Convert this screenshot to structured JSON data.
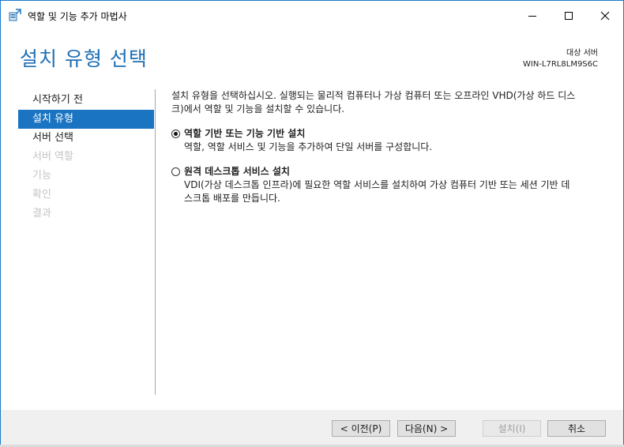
{
  "window": {
    "title": "역할 및 기능 추가 마법사"
  },
  "header": {
    "page_title": "설치 유형 선택",
    "server_label": "대상 서버",
    "server_name": "WIN-L7RL8LM9S6C"
  },
  "nav": {
    "items": [
      {
        "label": "시작하기 전",
        "state": "normal"
      },
      {
        "label": "설치 유형",
        "state": "active"
      },
      {
        "label": "서버 선택",
        "state": "normal"
      },
      {
        "label": "서버 역할",
        "state": "disabled"
      },
      {
        "label": "기능",
        "state": "disabled"
      },
      {
        "label": "확인",
        "state": "disabled"
      },
      {
        "label": "결과",
        "state": "disabled"
      }
    ]
  },
  "content": {
    "intro_line1": "설치 유형을 선택하십시오. 실행되는 물리적 컴퓨터나 가상 컴퓨터 또는 오프라인 VHD(가상 하드 디스",
    "intro_line2": "크)에서 역할 및 기능을 설치할 수 있습니다.",
    "options": [
      {
        "label": "역할 기반 또는 기능 기반 설치",
        "desc_line1": "역할, 역할 서비스 및 기능을 추가하여 단일 서버를 구성합니다.",
        "desc_line2": "",
        "selected": true
      },
      {
        "label": "원격 데스크톱 서비스 설치",
        "desc_line1": "VDI(가상 데스크톱 인프라)에 필요한 역할 서비스를 설치하여 가상 컴퓨터 기반 또는 세션 기반 데",
        "desc_line2": "스크톱 배포를 만듭니다.",
        "selected": false
      }
    ]
  },
  "footer": {
    "prev_label": "< 이전(P)",
    "next_label": "다음(N) >",
    "install_label": "설치(I)",
    "cancel_label": "취소"
  },
  "colors": {
    "accent": "#1a74c2",
    "title_blue": "#1f6fb5",
    "window_border": "#1979ca",
    "disabled_text": "#c3c3c3",
    "footer_bg": "#f0f0f0"
  },
  "icons": {
    "app": "server-manager-wizard-icon",
    "minimize": "minimize-icon",
    "maximize": "maximize-icon",
    "close": "close-icon"
  }
}
